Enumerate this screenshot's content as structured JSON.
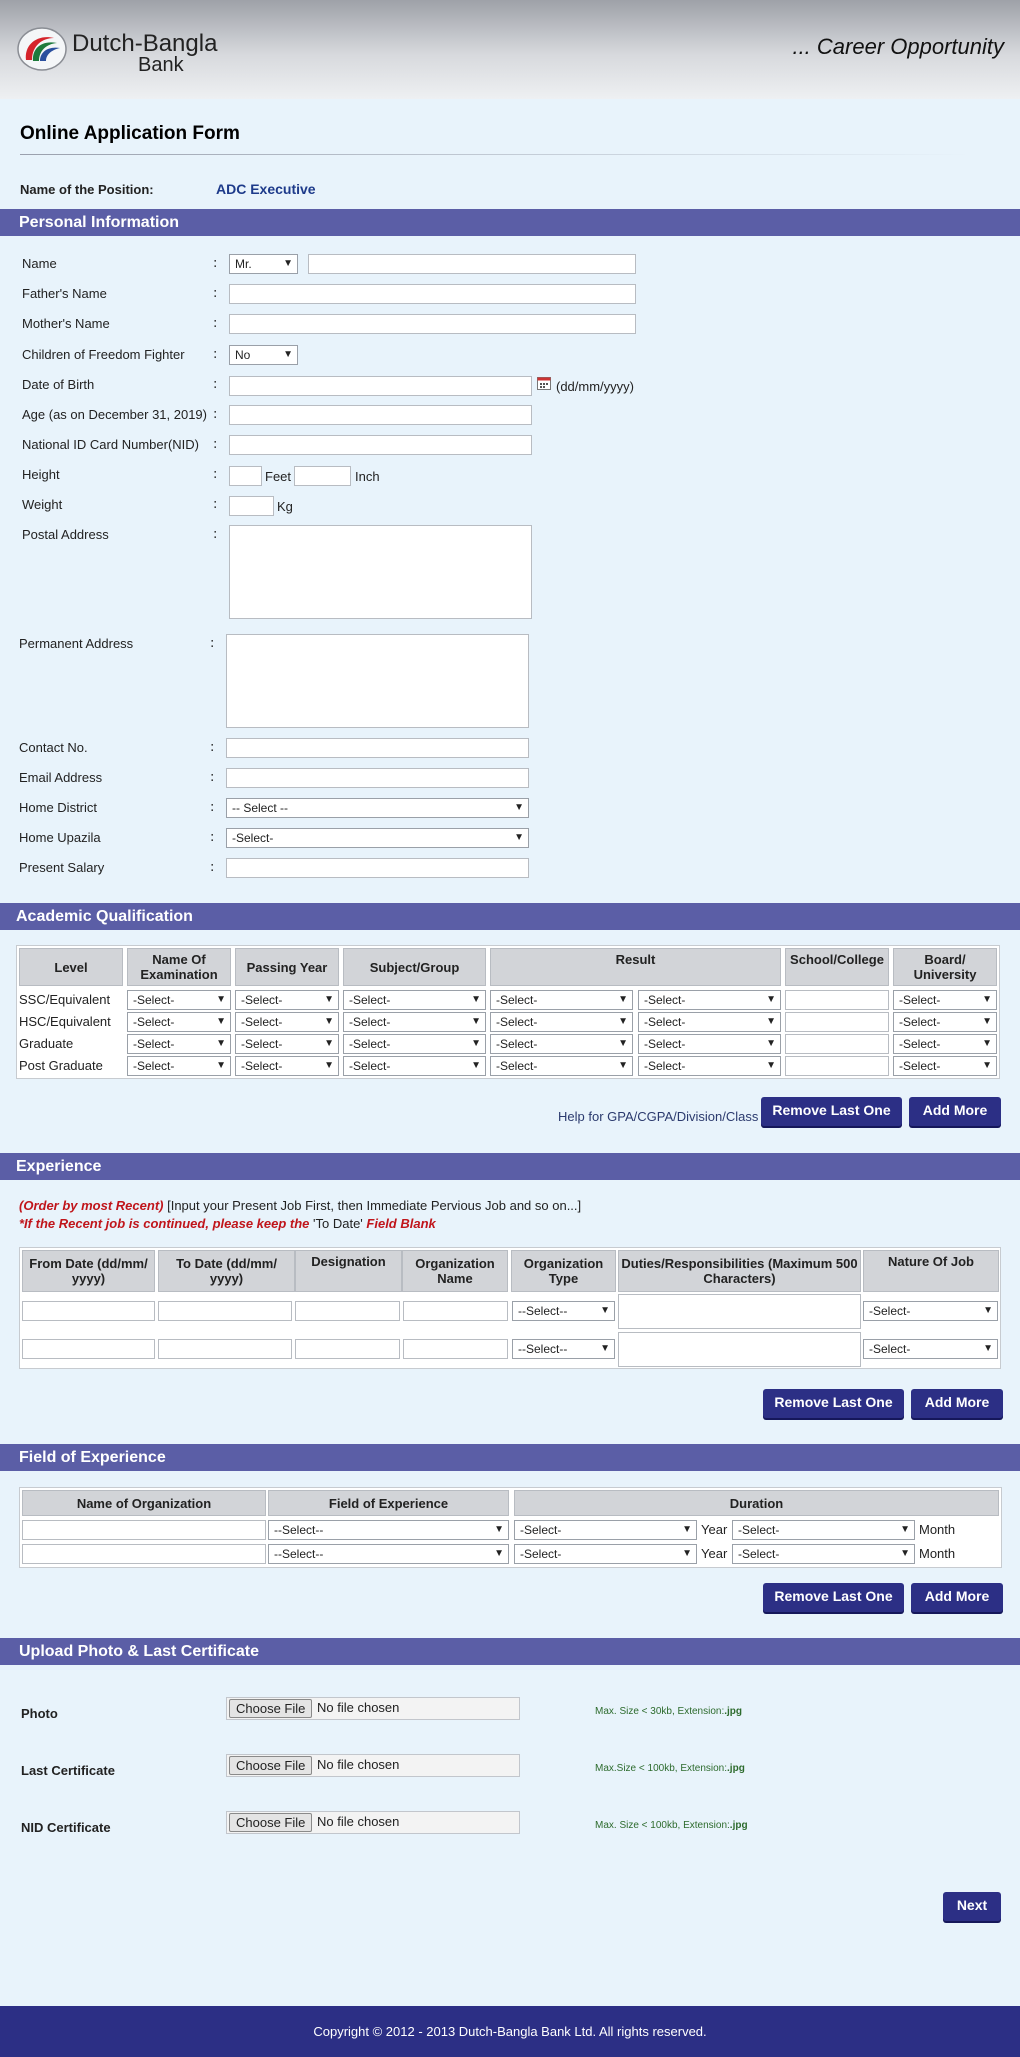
{
  "header": {
    "bank_name_1": "Dutch-Bangla",
    "bank_name_2": "Bank",
    "tagline": "... Career Opportunity"
  },
  "page_title": "Online Application Form",
  "position": {
    "label": "Name of the Position:",
    "value": "ADC Executive"
  },
  "sections": {
    "personal": "Personal Information",
    "academic": "Academic Qualification",
    "experience": "Experience",
    "field": "Field of Experience",
    "upload": "Upload Photo & Last Certificate"
  },
  "personal": {
    "name": "Name",
    "name_title": "Mr.",
    "father": "Father's Name",
    "mother": "Mother's Name",
    "ffighter": "Children of Freedom Fighter",
    "ffighter_value": "No",
    "dob": "Date of Birth",
    "dob_hint": "(dd/mm/yyyy)",
    "age": "Age (as on December 31, 2019)",
    "nid": "National ID Card Number(NID)",
    "height": "Height",
    "feet": "Feet",
    "inch": "Inch",
    "weight": "Weight",
    "kg": "Kg",
    "postal": "Postal Address",
    "permanent": "Permanent Address",
    "contact": "Contact No.",
    "email": "Email Address",
    "district": "Home District",
    "district_value": "-- Select --",
    "upazila": "Home Upazila",
    "upazila_value": "-Select-",
    "salary": "Present Salary",
    "colon": ":"
  },
  "academic": {
    "headers": [
      "Level",
      "Name Of Examination",
      "Passing Year",
      "Subject/Group",
      "Result",
      "School/College",
      "Board/ University"
    ],
    "rows": [
      "SSC/Equivalent",
      "HSC/Equivalent",
      "Graduate",
      "Post Graduate"
    ],
    "select": "-Select-",
    "help": "Help for GPA/CGPA/Division/Class",
    "remove": "Remove Last One",
    "add": "Add More"
  },
  "experience": {
    "note1_red": "(Order by most Recent)",
    "note1_rest": " [Input your Present Job First, then Immediate Pervious Job and so on...]",
    "note2_a": "*If the Recent job is continued, please keep the",
    "note2_b": " 'To Date' ",
    "note2_c": "Field Blank",
    "headers": [
      "From Date (dd/mm/ yyyy)",
      "To Date (dd/mm/ yyyy)",
      "Designation",
      "Organization Name",
      "Organization Type",
      "Duties/Responsibilities (Maximum 500 Characters)",
      "Nature Of Job"
    ],
    "org_select": "--Select--",
    "nature_select": "-Select-",
    "remove": "Remove Last One",
    "add": "Add More"
  },
  "field": {
    "headers": [
      "Name of Organization",
      "Field of Experience",
      "Duration"
    ],
    "field_select": "--Select--",
    "dur_select": "-Select-",
    "year": "Year",
    "month": "Month",
    "remove": "Remove Last One",
    "add": "Add More"
  },
  "upload": {
    "photo": "Photo",
    "photo_hint": "Max. Size < 30kb, Extension:",
    "cert": "Last Certificate",
    "cert_hint": "Max.Size < 100kb, Extension:",
    "nid": "NID Certificate",
    "nid_hint": "Max. Size < 100kb, Extension:",
    "ext": ".jpg",
    "choose": "Choose File",
    "nofile": "No file chosen"
  },
  "next": "Next",
  "footer": "Copyright © 2012 - 2013 Dutch-Bangla Bank Ltd. All rights reserved.",
  "colors": {
    "section_bar": "#5b5ea6",
    "button": "#2c2f85",
    "position_value": "#1d3a8a",
    "note_red": "#c0151b"
  }
}
